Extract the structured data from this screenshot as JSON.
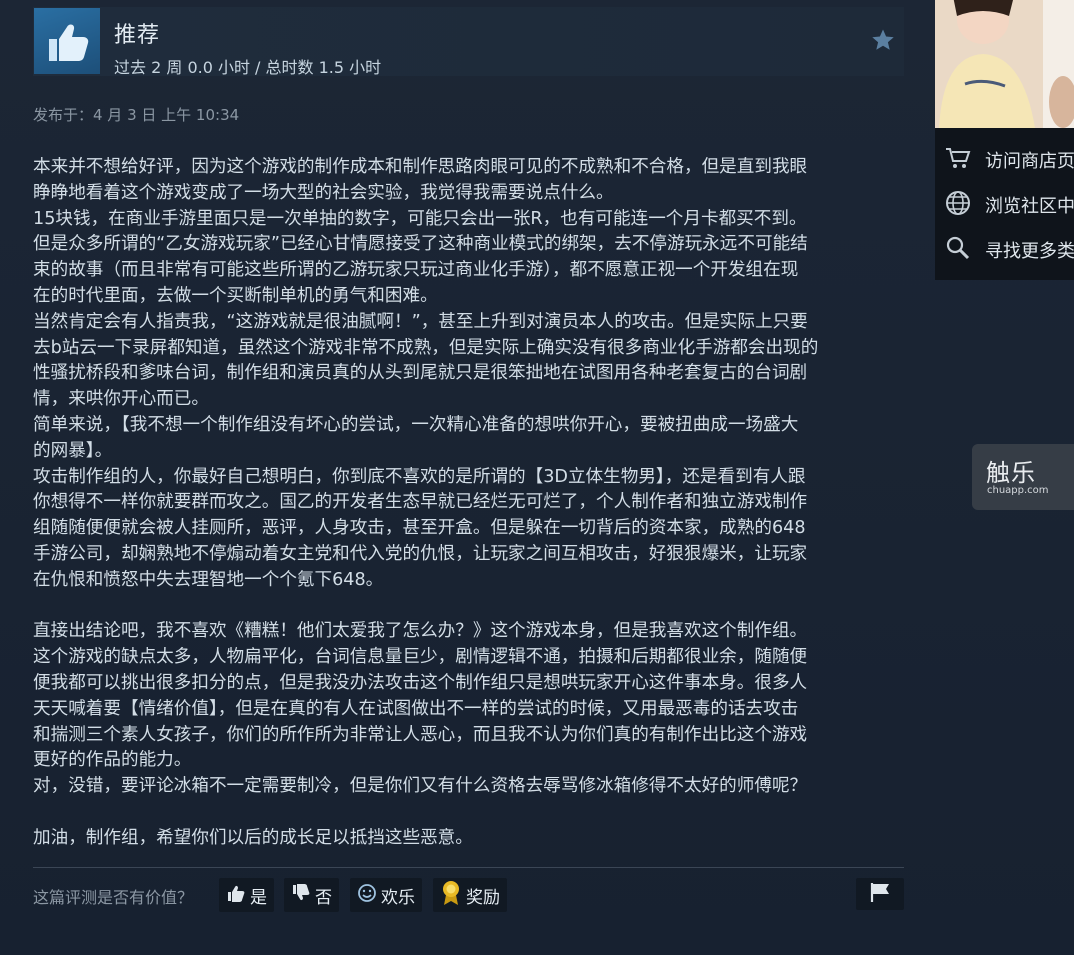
{
  "review": {
    "recommendation": "推荐",
    "hours": "过去 2 周 0.0 小时 / 总时数 1.5 小时",
    "posted": "发布于：4 月 3 日 上午 10:34",
    "body_lines": [
      "本来并不想给好评，因为这个游戏的制作成本和制作思路肉眼可见的不成熟和不合格，但是直到我眼",
      "睁睁地看着这个游戏变成了一场大型的社会实验，我觉得我需要说点什么。",
      "15块钱，在商业手游里面只是一次单抽的数字，可能只会出一张R，也有可能连一个月卡都买不到。",
      "但是众多所谓的“乙女游戏玩家”已经心甘情愿接受了这种商业模式的绑架，去不停游玩永远不可能结",
      "束的故事（而且非常有可能这些所谓的乙游玩家只玩过商业化手游），都不愿意正视一个开发组在现",
      "在的时代里面，去做一个买断制单机的勇气和困难。",
      "当然肯定会有人指责我，“这游戏就是很油腻啊！”，甚至上升到对演员本人的攻击。但是实际上只要",
      "去b站云一下录屏都知道，虽然这个游戏非常不成熟，但是实际上确实没有很多商业化手游都会出现的",
      "性骚扰桥段和爹味台词，制作组和演员真的从头到尾就只是很笨拙地在试图用各种老套复古的台词剧",
      "情，来哄你开心而已。",
      "简单来说，【我不想一个制作组没有坏心的尝试，一次精心准备的想哄你开心，要被扭曲成一场盛大",
      "的网暴】。",
      "攻击制作组的人，你最好自己想明白，你到底不喜欢的是所谓的【3D立体生物男】，还是看到有人跟",
      "你想得不一样你就要群而攻之。国乙的开发者生态早就已经烂无可烂了，个人制作者和独立游戏制作",
      "组随随便便就会被人挂厕所，恶评，人身攻击，甚至开盒。但是躲在一切背后的资本家，成熟的648",
      "手游公司，却娴熟地不停煽动着女主党和代入党的仇恨，让玩家之间互相攻击，好狠狠爆米，让玩家",
      "在仇恨和愤怒中失去理智地一个个氪下648。",
      "",
      "直接出结论吧，我不喜欢《糟糕！他们太爱我了怎么办？》这个游戏本身，但是我喜欢这个制作组。",
      "这个游戏的缺点太多，人物扁平化，台词信息量巨少，剧情逻辑不通，拍摄和后期都很业余，随随便",
      "便我都可以挑出很多扣分的点，但是我没办法攻击这个制作组只是想哄玩家开心这件事本身。很多人",
      "天天喊着要【情绪价值】，但是在真的有人在试图做出不一样的尝试的时候，又用最恶毒的话去攻击",
      "和揣测三个素人女孩子，你们的所作所为非常让人恶心，而且我不认为你们真的有制作出比这个游戏",
      "更好的作品的能力。",
      "对，没错，要评论冰箱不一定需要制冷，但是你们又有什么资格去辱骂修冰箱修得不太好的师傅呢？",
      "",
      "加油，制作组，希望你们以后的成长足以抵挡这些恶意。"
    ]
  },
  "footer": {
    "question": "这篇评测是否有价值？",
    "yes": "是",
    "no": "否",
    "funny": "欢乐",
    "award": "奖励"
  },
  "sidebar": {
    "links": [
      {
        "label": "访问商店页",
        "icon": "cart-icon"
      },
      {
        "label": "浏览社区中",
        "icon": "globe-icon"
      },
      {
        "label": "寻找更多类",
        "icon": "search-icon"
      }
    ]
  },
  "watermark": {
    "main": "触乐",
    "sub": "chuapp.com"
  },
  "colors": {
    "background": "#1b2534",
    "header": "#1f2c3c",
    "thumb": "#2a6fa3",
    "text": "#d2dde6",
    "muted": "#8b97a3",
    "button": "#111923",
    "award": "#e8b925"
  }
}
